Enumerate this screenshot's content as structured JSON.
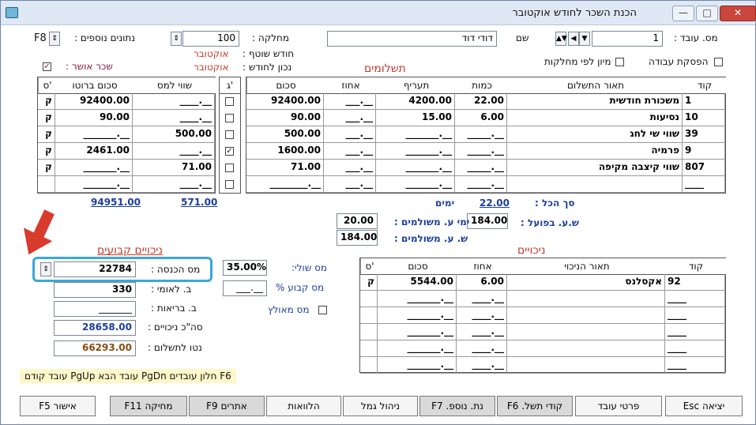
{
  "window": {
    "title": "הכנת השכר לחודש אוקטובר"
  },
  "header": {
    "employee_no_label": "מס. עובד :",
    "employee_no_value": "1",
    "name_label": "שם",
    "name_value": "דודי דוד",
    "dept_label": "מחלקה :",
    "dept_value": "100",
    "extra_data_label": "נתונים נוספים :",
    "extra_data_value": "F8",
    "current_month_label": "חודש שוטף :",
    "current_month_value": "אוקטובר",
    "correct_for_month_label": "נכון לחודש :",
    "correct_for_month_value": "אוקטובר",
    "approved_salary_label": "שכר אושר :",
    "stop_work_label": "הפסקת עבודה",
    "sort_by_dept_label": "מיון לפי מחלקות"
  },
  "payments": {
    "title": "תשלומים",
    "columns": [
      "קוד",
      "תאור התשלום",
      "כמות",
      "תעריף",
      "אחוז",
      "סכום"
    ],
    "rows": [
      {
        "code": "1",
        "desc": "משכורת חודשית",
        "qty": "22.00",
        "rate": "4200.00",
        "pct": "___.__",
        "sum": "92400.00",
        "g": false,
        "tax_value": "____.__",
        "gross": "92400.00",
        "s": "ק"
      },
      {
        "code": "10",
        "desc": "נסיעות",
        "qty": "6.00",
        "rate": "15.00",
        "pct": "___.__",
        "sum": "90.00",
        "g": false,
        "tax_value": "____.__",
        "gross": "90.00",
        "s": "ק"
      },
      {
        "code": "39",
        "desc": "שווי שי לחג",
        "qty": "_____.__",
        "rate": "_______.__",
        "pct": "___.__",
        "sum": "500.00",
        "g": false,
        "tax_value": "500.00",
        "gross": "_______.__",
        "s": "ק"
      },
      {
        "code": "9",
        "desc": "פרמיה",
        "qty": "_____.__",
        "rate": "_______.__",
        "pct": "___.__",
        "sum": "1600.00",
        "g": true,
        "tax_value": "____.__",
        "gross": "2461.00",
        "s": "ק"
      },
      {
        "code": "807",
        "desc": "שווי קיצבה מקיפה",
        "qty": "_____.__",
        "rate": "_______.__",
        "pct": "___.__",
        "sum": "71.00",
        "g": false,
        "tax_value": "71.00",
        "gross": "_______.__",
        "s": "ק"
      },
      {
        "code": "____",
        "desc": "",
        "qty": "_____.__",
        "rate": "_______.__",
        "pct": "___.__",
        "sum": "________.__",
        "g": false,
        "tax_value": "____.__",
        "gross": "_______.__",
        "s": ""
      }
    ],
    "g_header": "ג'",
    "tax_value_header": "שווי למס",
    "gross_header": "סכום ברוטו",
    "s_header": "ס'",
    "total_label": "סך הכל :",
    "total_qty": "22.00",
    "days_label": "ימים",
    "total_tax_value": "571.00",
    "total_gross": "94951.00",
    "actual_hours_label": "ש.ע. בפועל :",
    "actual_hours_value": "184.00",
    "paid_days_label": "ימי ע. משולמים :",
    "paid_days_value": "20.00",
    "paid_hours_label": "ש. ע. משולמים :",
    "paid_hours_value": "184.00"
  },
  "fixed_deductions": {
    "title": "ניכויים קבועים",
    "income_tax_label": "מס הכנסה :",
    "income_tax_value": "22784",
    "national_ins_label": "ב. לאומי :",
    "national_ins_value": "330",
    "health_label": "ב. בריאות :",
    "health_value": "_______",
    "total_ded_label": "סה\"כ ניכויים :",
    "total_ded_value": "28658.00",
    "net_label": "נטו לתשלום :",
    "net_value": "66293.00",
    "marginal_tax_label": "מס שולי:",
    "marginal_tax_value": "35.00%",
    "fixed_tax_label": "מס קבוע %",
    "fixed_tax_value": "___.__",
    "forced_tax_label": "מס מאולץ"
  },
  "deductions": {
    "title": "ניכויים",
    "columns": [
      "קוד",
      "תאור הניכוי",
      "אחוז",
      "סכום",
      "ס'"
    ],
    "rows": [
      {
        "code": "92",
        "desc": "אקסלנס",
        "pct": "6.00",
        "sum": "5544.00",
        "s": "ק"
      },
      {
        "code": "____",
        "desc": "",
        "pct": "____.__",
        "sum": "_______.__",
        "s": ""
      },
      {
        "code": "____",
        "desc": "",
        "pct": "____.__",
        "sum": "_______.__",
        "s": ""
      },
      {
        "code": "____",
        "desc": "",
        "pct": "____.__",
        "sum": "_______.__",
        "s": ""
      },
      {
        "code": "____",
        "desc": "",
        "pct": "____.__",
        "sum": "_______.__",
        "s": ""
      },
      {
        "code": "____",
        "desc": "",
        "pct": "____.__",
        "sum": "_______.__",
        "s": ""
      }
    ]
  },
  "hints": "F6 חלון עובדים   PgDn עובד הבא   PgUp עובד קודם",
  "buttons": {
    "exit": "יציאה Esc",
    "employee_details": "פרטי עובד",
    "payment_codes": "קודי תשל. F6",
    "extra_data": "נת. נוספ. F7",
    "pension": "ניהול גמל",
    "loans": "הלוואות",
    "search": "אתרים F9",
    "delete": "מחיקה F11",
    "approve": "אישור F5"
  }
}
